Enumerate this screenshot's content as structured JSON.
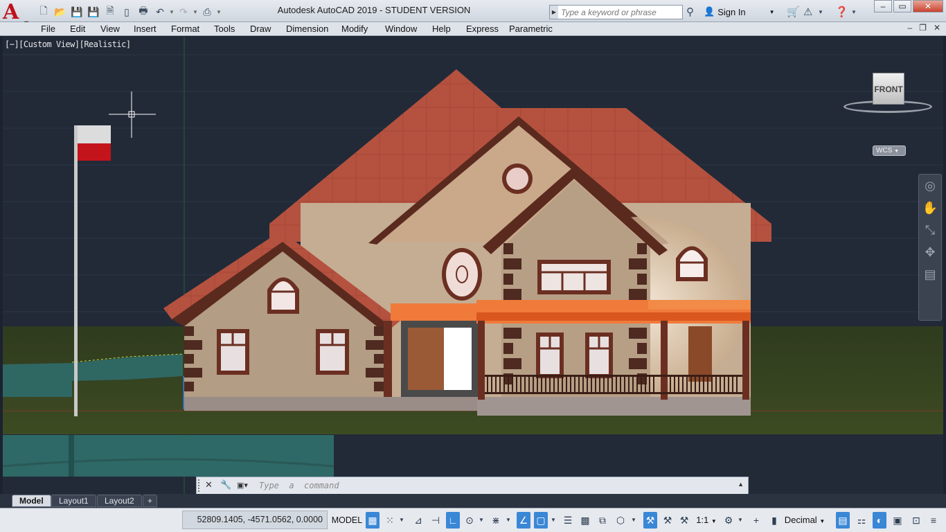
{
  "titlebar": {
    "app_logo": "A",
    "title": "Autodesk AutoCAD 2019 - STUDENT VERSION",
    "search_placeholder": "Type a keyword or phrase",
    "sign_in": "Sign In"
  },
  "menu": [
    "File",
    "Edit",
    "View",
    "Insert",
    "Format",
    "Tools",
    "Draw",
    "Dimension",
    "Modify",
    "Window",
    "Help",
    "Express",
    "Parametric"
  ],
  "viewport": {
    "label": "[−][Custom View][Realistic]",
    "viewcube_face": "FRONT",
    "wcs": "WCS"
  },
  "command": {
    "placeholder": "Type  a  command"
  },
  "layout_tabs": [
    "Model",
    "Layout1",
    "Layout2",
    "+"
  ],
  "status": {
    "coordinates": "52809.1405, -4571.0562, 0.0000",
    "space": "MODEL",
    "annotation_scale": "1:1",
    "units": "Decimal"
  },
  "colors": {
    "background": "#222a38",
    "roof": "#b5523f",
    "wall": "#b39d84",
    "trim": "#5b2a1f",
    "ground": "#3b4a22",
    "awning": "#e8642a",
    "accent": "#3a87d6"
  }
}
